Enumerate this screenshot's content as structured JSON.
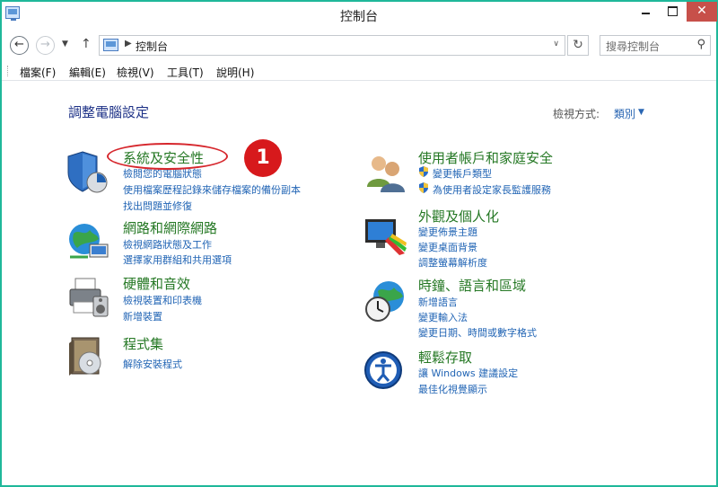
{
  "window": {
    "title": "控制台"
  },
  "address": {
    "path": "控制台",
    "search_placeholder": "搜尋控制台"
  },
  "menu": [
    "檔案(F)",
    "編輯(E)",
    "檢視(V)",
    "工具(T)",
    "說明(H)"
  ],
  "header": {
    "title": "調整電腦設定",
    "viewby_label": "檢視方式:",
    "viewby_value": "類別"
  },
  "annotation": {
    "badge": "1"
  },
  "categories": {
    "system": {
      "title": "系統及安全性",
      "links": [
        "檢閱您的電腦狀態",
        "使用檔案歷程記錄來儲存檔案的備份副本",
        "找出問題並修復"
      ]
    },
    "network": {
      "title": "網路和網際網路",
      "links": [
        "檢視網路狀態及工作",
        "選擇家用群組和共用選項"
      ]
    },
    "hardware": {
      "title": "硬體和音效",
      "links": [
        "檢視裝置和印表機",
        "新增裝置"
      ]
    },
    "programs": {
      "title": "程式集",
      "links": [
        "解除安裝程式"
      ]
    },
    "users": {
      "title": "使用者帳戶和家庭安全",
      "links": [
        "變更帳戶類型",
        "為使用者設定家長監護服務"
      ]
    },
    "appearance": {
      "title": "外觀及個人化",
      "links": [
        "變更佈景主題",
        "變更桌面背景",
        "調整螢幕解析度"
      ]
    },
    "clock": {
      "title": "時鐘、語言和區域",
      "links": [
        "新增語言",
        "變更輸入法",
        "變更日期、時間或數字格式"
      ]
    },
    "access": {
      "title": "輕鬆存取",
      "links": [
        "讓 Windows 建議設定",
        "最佳化視覺顯示"
      ]
    }
  }
}
